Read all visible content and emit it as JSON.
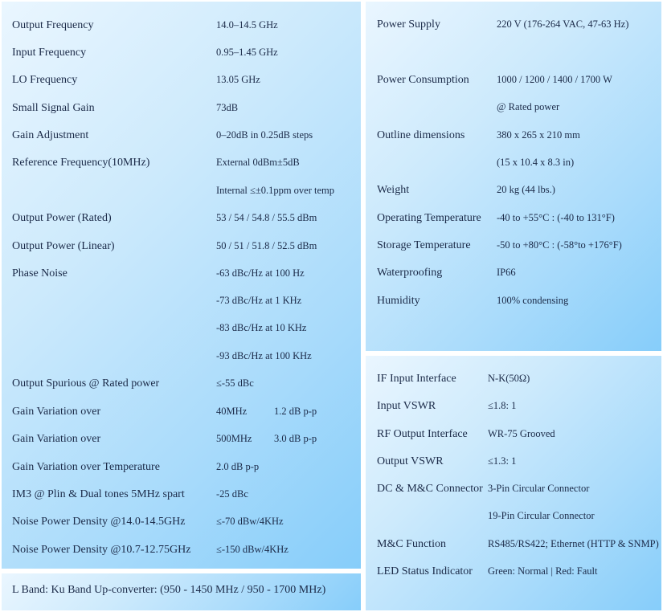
{
  "left_table": [
    {
      "label": "Output Frequency",
      "value": "14.0–14.5 GHz"
    },
    {
      "label": "Input Frequency",
      "value": "0.95–1.45 GHz"
    },
    {
      "label": "LO Frequency",
      "value": "13.05 GHz"
    },
    {
      "label": "Small Signal Gain",
      "value": "73dB"
    },
    {
      "label": "Gain Adjustment",
      "value": "0–20dB in 0.25dB steps"
    },
    {
      "label": "Reference Frequency(10MHz)",
      "value": "External 0dBm±5dB"
    },
    {
      "label": "",
      "value": "Internal ≤±0.1ppm over temp"
    },
    {
      "label": "Output Power (Rated)",
      "value": "53 / 54 / 54.8 / 55.5 dBm"
    },
    {
      "label": "Output Power (Linear)",
      "value": "50 / 51 / 51.8 / 52.5 dBm"
    },
    {
      "label": "Phase Noise",
      "value": "-63 dBc/Hz at 100 Hz"
    },
    {
      "label": "",
      "value": "-73 dBc/Hz at 1 KHz"
    },
    {
      "label": "",
      "value": "-83 dBc/Hz at 10 KHz"
    },
    {
      "label": "",
      "value": "-93 dBc/Hz at 100 KHz"
    },
    {
      "label": "Output Spurious @ Rated power",
      "value": "≤-55 dBc"
    },
    {
      "label": "Gain Variation over",
      "value": "40MHz",
      "value2": "1.2 dB p-p"
    },
    {
      "label": "Gain Variation over",
      "value": "500MHz",
      "value2": "3.0 dB p-p"
    },
    {
      "label": "Gain Variation over Temperature",
      "value": "2.0 dB p-p"
    },
    {
      "label": "IM3 @ Plin & Dual tones 5MHz spart",
      "value": "-25 dBc"
    },
    {
      "label": "Noise Power Density @14.0-14.5GHz",
      "value": "≤-70 dBw/4KHz"
    },
    {
      "label": "Noise Power Density @10.7-12.75GHz",
      "value": "≤-150 dBw/4KHz"
    }
  ],
  "caption": "L Band: Ku Band Up-converter: (950 - 1450 MHz / 950 - 1700 MHz)",
  "right_top_table": [
    {
      "label": "Power Supply",
      "value": "220 V (176-264 VAC, 47-63 Hz)"
    },
    {
      "label": "Power Consumption",
      "value": "1000 / 1200 / 1400 / 1700 W"
    },
    {
      "label": "",
      "value": "@ Rated power"
    },
    {
      "label": "Outline dimensions",
      "value": "380 x 265 x 210 mm"
    },
    {
      "label": "",
      "value": "(15 x 10.4 x 8.3 in)"
    },
    {
      "label": "Weight",
      "value": "20 kg (44 lbs.)"
    },
    {
      "label": "Operating Temperature",
      "value": "-40 to +55°C : (-40 to 131°F)"
    },
    {
      "label": "Storage Temperature",
      "value": "-50 to +80°C : (-58°to +176°F)"
    },
    {
      "label": "Waterproofing",
      "value": "IP66"
    },
    {
      "label": "Humidity",
      "value": "100% condensing"
    }
  ],
  "right_bottom_table": [
    {
      "label": "IF Input Interface",
      "value": "N-K(50Ω)"
    },
    {
      "label": "Input VSWR",
      "value": "≤1.8: 1"
    },
    {
      "label": "RF Output Interface",
      "value": "WR-75 Grooved"
    },
    {
      "label": "Output VSWR",
      "value": "≤1.3: 1"
    },
    {
      "label": "DC & M&C Connector",
      "value": "3-Pin Circular Connector"
    },
    {
      "label": "",
      "value": "19-Pin Circular Connector"
    },
    {
      "label": "M&C Function",
      "value": "RS485/RS422; Ethernet (HTTP & SNMP)"
    },
    {
      "label": "LED Status Indicator",
      "value": "Green: Normal | Red: Fault"
    }
  ]
}
